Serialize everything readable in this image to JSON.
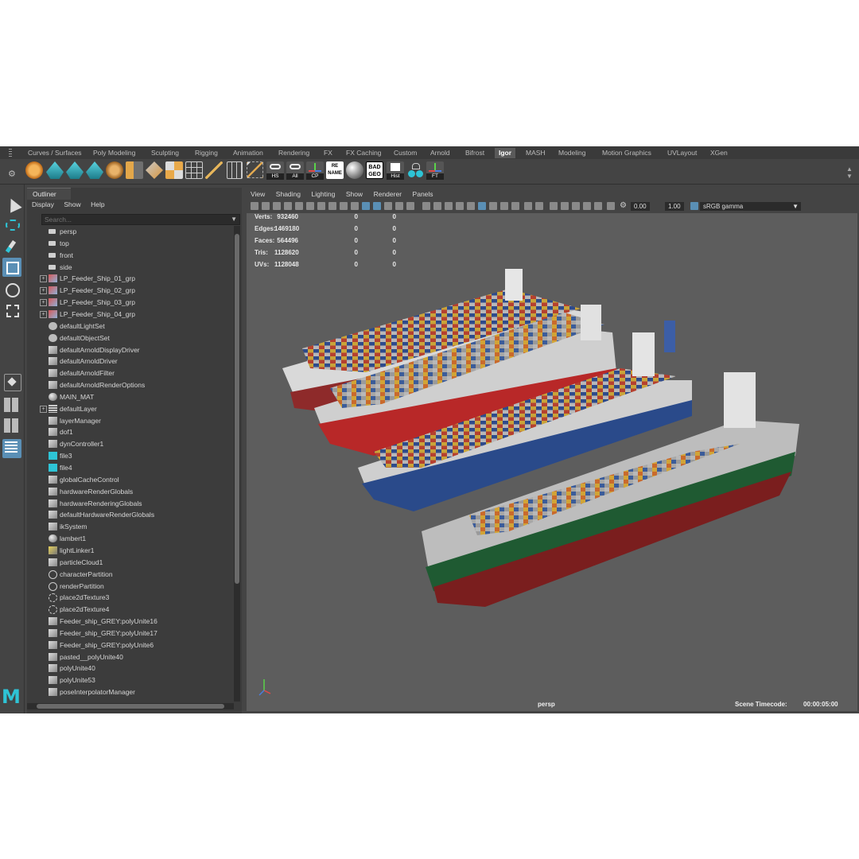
{
  "shelf_tabs": [
    "Curves / Surfaces",
    "Poly Modeling",
    "Sculpting",
    "Rigging",
    "Animation",
    "Rendering",
    "FX",
    "FX Caching",
    "Custom",
    "Arnold",
    "Bifrost",
    "Igor",
    "MASH",
    "Modeling",
    "Motion Graphics",
    "UVLayout",
    "XGen"
  ],
  "active_shelf_tab": "Igor",
  "shelf_icon_labels": {
    "hs": "HS",
    "all": "All",
    "cp": "CP",
    "rename": "RE\nNAME",
    "badgeo": "BAD\nGEO",
    "hist": "Hist",
    "ft": "FT"
  },
  "outliner": {
    "tab": "Outliner",
    "menu": [
      "Display",
      "Show",
      "Help"
    ],
    "search_placeholder": "Search...",
    "items": [
      {
        "label": "persp",
        "icon": "camera-icon"
      },
      {
        "label": "top",
        "icon": "camera-icon"
      },
      {
        "label": "front",
        "icon": "camera-icon"
      },
      {
        "label": "side",
        "icon": "camera-icon"
      },
      {
        "label": "LP_Feeder_Ship_01_grp",
        "icon": "group-icon",
        "expand": true
      },
      {
        "label": "LP_Feeder_Ship_02_grp",
        "icon": "group-icon",
        "expand": true
      },
      {
        "label": "LP_Feeder_Ship_03_grp",
        "icon": "group-icon",
        "expand": true
      },
      {
        "label": "LP_Feeder_Ship_04_grp",
        "icon": "group-icon",
        "expand": true
      },
      {
        "label": "defaultLightSet",
        "icon": "set-icon"
      },
      {
        "label": "defaultObjectSet",
        "icon": "set-icon"
      },
      {
        "label": "defaultArnoldDisplayDriver",
        "icon": "node-icon"
      },
      {
        "label": "defaultArnoldDriver",
        "icon": "node-icon"
      },
      {
        "label": "defaultArnoldFilter",
        "icon": "node-icon"
      },
      {
        "label": "defaultArnoldRenderOptions",
        "icon": "node-icon"
      },
      {
        "label": "MAIN_MAT",
        "icon": "material-icon"
      },
      {
        "label": "defaultLayer",
        "icon": "layer-icon",
        "expand": true
      },
      {
        "label": "layerManager",
        "icon": "node-icon"
      },
      {
        "label": "dof1",
        "icon": "node-icon"
      },
      {
        "label": "dynController1",
        "icon": "node-icon"
      },
      {
        "label": "file3",
        "icon": "file-texture-icon"
      },
      {
        "label": "file4",
        "icon": "file-texture-icon"
      },
      {
        "label": "globalCacheControl",
        "icon": "node-icon"
      },
      {
        "label": "hardwareRenderGlobals",
        "icon": "node-icon"
      },
      {
        "label": "hardwareRenderingGlobals",
        "icon": "node-icon"
      },
      {
        "label": "defaultHardwareRenderGlobals",
        "icon": "node-icon"
      },
      {
        "label": "ikSystem",
        "icon": "node-icon"
      },
      {
        "label": "lambert1",
        "icon": "material-icon"
      },
      {
        "label": "lightLinker1",
        "icon": "light-linker-icon"
      },
      {
        "label": "particleCloud1",
        "icon": "node-icon"
      },
      {
        "label": "characterPartition",
        "icon": "partition-icon"
      },
      {
        "label": "renderPartition",
        "icon": "partition-icon"
      },
      {
        "label": "place2dTexture3",
        "icon": "place2d-icon"
      },
      {
        "label": "place2dTexture4",
        "icon": "place2d-icon"
      },
      {
        "label": "Feeder_ship_GREY:polyUnite16",
        "icon": "node-icon"
      },
      {
        "label": "Feeder_ship_GREY:polyUnite17",
        "icon": "node-icon"
      },
      {
        "label": "Feeder_ship_GREY:polyUnite6",
        "icon": "node-icon"
      },
      {
        "label": "pasted__polyUnite40",
        "icon": "node-icon"
      },
      {
        "label": "polyUnite40",
        "icon": "node-icon"
      },
      {
        "label": "polyUnite53",
        "icon": "node-icon"
      },
      {
        "label": "poseInterpolatorManager",
        "icon": "node-icon"
      }
    ]
  },
  "viewport": {
    "menu": [
      "View",
      "Shading",
      "Lighting",
      "Show",
      "Renderer",
      "Panels"
    ],
    "exposure": "0.00",
    "gamma": "1.00",
    "color_space": "sRGB gamma",
    "camera_label": "persp",
    "timecode_label": "Scene Timecode:",
    "timecode_value": "00:00:05:00",
    "hud": [
      {
        "label": "Verts:",
        "v1": "932460",
        "v2": "0",
        "v3": "0"
      },
      {
        "label": "Edges:",
        "v1": "1469180",
        "v2": "0",
        "v3": "0"
      },
      {
        "label": "Faces:",
        "v1": "564496",
        "v2": "0",
        "v3": "0"
      },
      {
        "label": "Tris:",
        "v1": "1128620",
        "v2": "0",
        "v3": "0"
      },
      {
        "label": "UVs:",
        "v1": "1128048",
        "v2": "0",
        "v3": "0"
      }
    ]
  },
  "colors": {
    "accent": "#5a8fb5",
    "maya_teal": "#2ec4d6",
    "viewport_bg": "#5d5d5d"
  }
}
